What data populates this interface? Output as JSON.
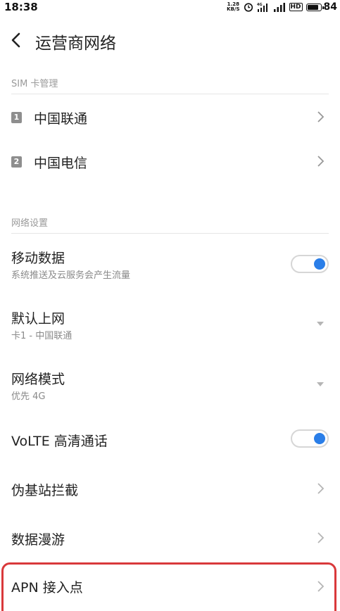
{
  "status_bar": {
    "time": "18:38",
    "net_speed_value": "1.28",
    "net_speed_unit": "KB/S",
    "hd_label": "HD",
    "battery_percent": "84",
    "battery_level": 0.84,
    "icons": [
      "alarm-icon",
      "signal-4g-icon",
      "signal-icon",
      "battery-icon"
    ]
  },
  "header": {
    "title": "运营商网络"
  },
  "sim_section": {
    "label": "SIM 卡管理",
    "items": [
      {
        "slot": "1",
        "name": "中国联通"
      },
      {
        "slot": "2",
        "name": "中国电信"
      }
    ]
  },
  "network_section": {
    "label": "网络设置",
    "mobile_data": {
      "title": "移动数据",
      "subtitle": "系统推送及云服务会产生流量",
      "enabled": true
    },
    "default_internet": {
      "title": "默认上网",
      "value": "卡1 - 中国联通"
    },
    "network_mode": {
      "title": "网络模式",
      "value": "优先 4G"
    },
    "volte": {
      "title": "VoLTE 高清通话",
      "enabled": true
    },
    "fake_base_station": {
      "title": "伪基站拦截"
    },
    "data_roaming": {
      "title": "数据漫游"
    },
    "apn": {
      "title": "APN 接入点"
    }
  },
  "colors": {
    "accent": "#2a7ee8",
    "highlight": "#d9393b",
    "section_label": "#9a9a9a"
  }
}
